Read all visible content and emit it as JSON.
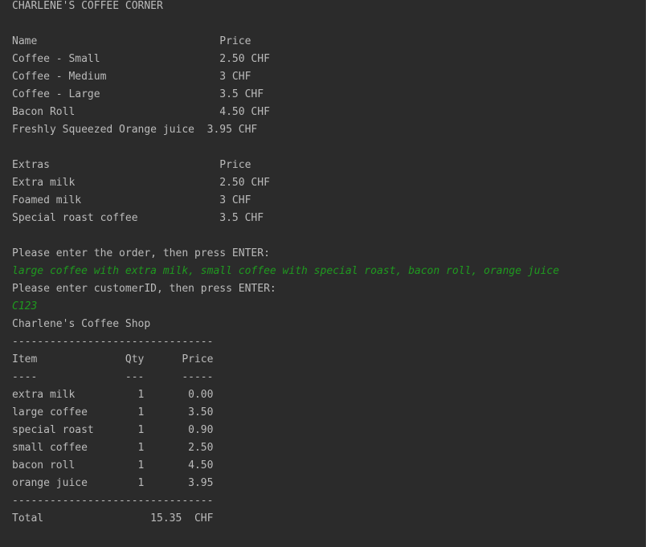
{
  "console": {
    "lines": [
      {
        "text": "CHARLENE'S COFFEE CORNER",
        "kind": "output"
      },
      {
        "text": "",
        "kind": "output"
      },
      {
        "text": "Name                             Price",
        "kind": "output"
      },
      {
        "text": "Coffee - Small                   2.50 CHF",
        "kind": "output"
      },
      {
        "text": "Coffee - Medium                  3 CHF",
        "kind": "output"
      },
      {
        "text": "Coffee - Large                   3.5 CHF",
        "kind": "output"
      },
      {
        "text": "Bacon Roll                       4.50 CHF",
        "kind": "output"
      },
      {
        "text": "Freshly Squeezed Orange juice  3.95 CHF",
        "kind": "output"
      },
      {
        "text": "",
        "kind": "output"
      },
      {
        "text": "Extras                           Price",
        "kind": "output"
      },
      {
        "text": "Extra milk                       2.50 CHF",
        "kind": "output"
      },
      {
        "text": "Foamed milk                      3 CHF",
        "kind": "output"
      },
      {
        "text": "Special roast coffee             3.5 CHF",
        "kind": "output"
      },
      {
        "text": "",
        "kind": "output"
      },
      {
        "text": "Please enter the order, then press ENTER:",
        "kind": "output"
      },
      {
        "text": "large coffee with extra milk, small coffee with special roast, bacon roll, orange juice",
        "kind": "input"
      },
      {
        "text": "Please enter customerID, then press ENTER:",
        "kind": "output"
      },
      {
        "text": "C123",
        "kind": "input"
      },
      {
        "text": "Charlene's Coffee Shop",
        "kind": "output"
      },
      {
        "text": "--------------------------------",
        "kind": "output"
      },
      {
        "text": "Item              Qty      Price",
        "kind": "output"
      },
      {
        "text": "----              ---      -----",
        "kind": "output"
      },
      {
        "text": "extra milk          1       0.00",
        "kind": "output"
      },
      {
        "text": "large coffee        1       3.50",
        "kind": "output"
      },
      {
        "text": "special roast       1       0.90",
        "kind": "output"
      },
      {
        "text": "small coffee        1       2.50",
        "kind": "output"
      },
      {
        "text": "bacon roll          1       4.50",
        "kind": "output"
      },
      {
        "text": "orange juice        1       3.95",
        "kind": "output"
      },
      {
        "text": "--------------------------------",
        "kind": "output"
      },
      {
        "text": "Total                 15.35  CHF",
        "kind": "output"
      }
    ]
  }
}
